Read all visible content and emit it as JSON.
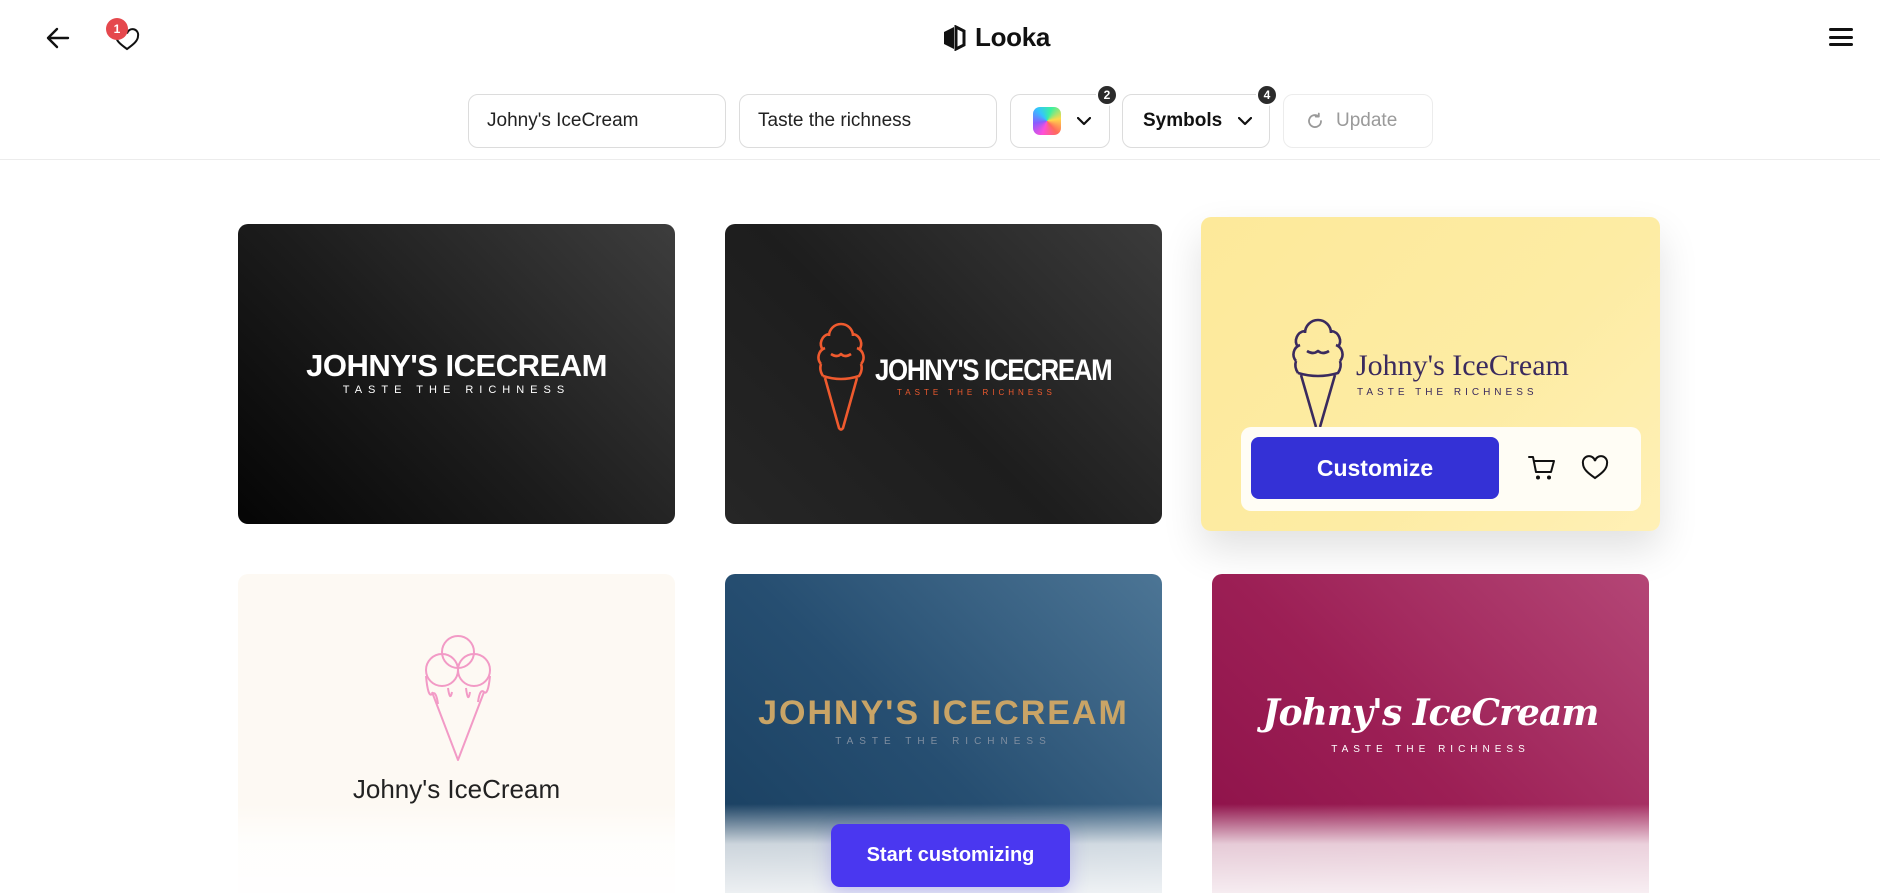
{
  "header": {
    "back_icon": "arrow-left-icon",
    "favorites_icon": "heart-icon",
    "favorites_count": "1",
    "brand_name": "Looka",
    "menu_icon": "hamburger-menu-icon"
  },
  "toolbar": {
    "company_name_value": "Johny's IceCream",
    "slogan_value": "Taste the richness",
    "colors_count": "2",
    "symbols_label": "Symbols",
    "symbols_count": "4",
    "update_label": "Update"
  },
  "cards": [
    {
      "name": "JOHNY'S ICECREAM",
      "tagline": "TASTE THE RICHNESS",
      "background": "#1c1c1c",
      "text_color": "#ffffff"
    },
    {
      "name": "JOHNY'S ICECREAM",
      "tagline": "TASTE THE RICHNESS",
      "background": "#232323",
      "text_color": "#ffffff",
      "accent": "#ef5a2e"
    },
    {
      "name": "Johny's IceCream",
      "tagline": "TASTE THE RICHNESS",
      "background": "#fde99a",
      "text_color": "#3a2a5e"
    },
    {
      "name": "Johny's IceCream",
      "background": "#fdf9f3",
      "text_color": "#222222",
      "accent": "#f29ac6"
    },
    {
      "name": "JOHNY'S ICECREAM",
      "tagline": "TASTE THE RICHNESS",
      "background": "#264e71",
      "text_color": "#c9a466"
    },
    {
      "name": "Johny's IceCream",
      "tagline": "TASTE THE RICHNESS",
      "background": "#9c1f55",
      "text_color": "#ffffff"
    }
  ],
  "card_actions": {
    "customize_label": "Customize",
    "cart_icon": "cart-icon",
    "favorite_icon": "heart-icon"
  },
  "cta": {
    "label": "Start customizing",
    "color": "#4a37f0"
  }
}
